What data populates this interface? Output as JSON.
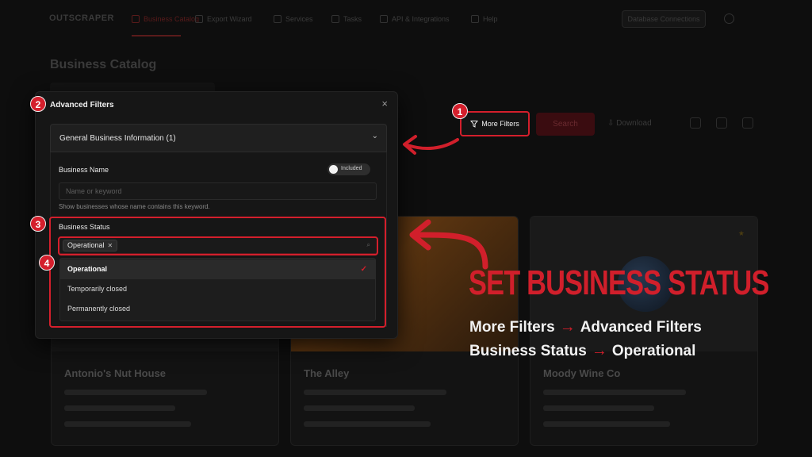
{
  "nav": {
    "logo": "OUTSCRAPER",
    "items": [
      "Business Catalog",
      "Export Wizard",
      "Services",
      "Tasks",
      "API & Integrations",
      "Help"
    ],
    "cta": "Database Connections"
  },
  "page": {
    "title": "Business Catalog"
  },
  "toolbar": {
    "more_filters": "More Filters",
    "search": "Search",
    "download": "Download"
  },
  "modal": {
    "title": "Advanced Filters",
    "close": "×",
    "section": "General Business Information (1)",
    "business_name": {
      "label": "Business Name",
      "toggle": "Included",
      "placeholder": "Name or keyword",
      "helper": "Show businesses whose name contains this keyword."
    },
    "business_status": {
      "label": "Business Status",
      "selected_chip": "Operational",
      "options": [
        "Operational",
        "Temporarily closed",
        "Permanently closed"
      ],
      "selected_index": 0
    }
  },
  "cards": [
    {
      "name": "Antonio's Nut House"
    },
    {
      "name": "The Alley"
    },
    {
      "name": "Moody Wine Co"
    }
  ],
  "annotations": {
    "steps": [
      "1",
      "2",
      "3",
      "4"
    ],
    "headline": "SET BUSINESS STATUS",
    "path1": {
      "from": "More Filters",
      "to": "Advanced Filters"
    },
    "path2": {
      "from": "Business Status",
      "to": "Operational"
    }
  },
  "colors": {
    "accent": "#d11f2b",
    "background": "#0e0e0e",
    "panel": "#161616"
  }
}
